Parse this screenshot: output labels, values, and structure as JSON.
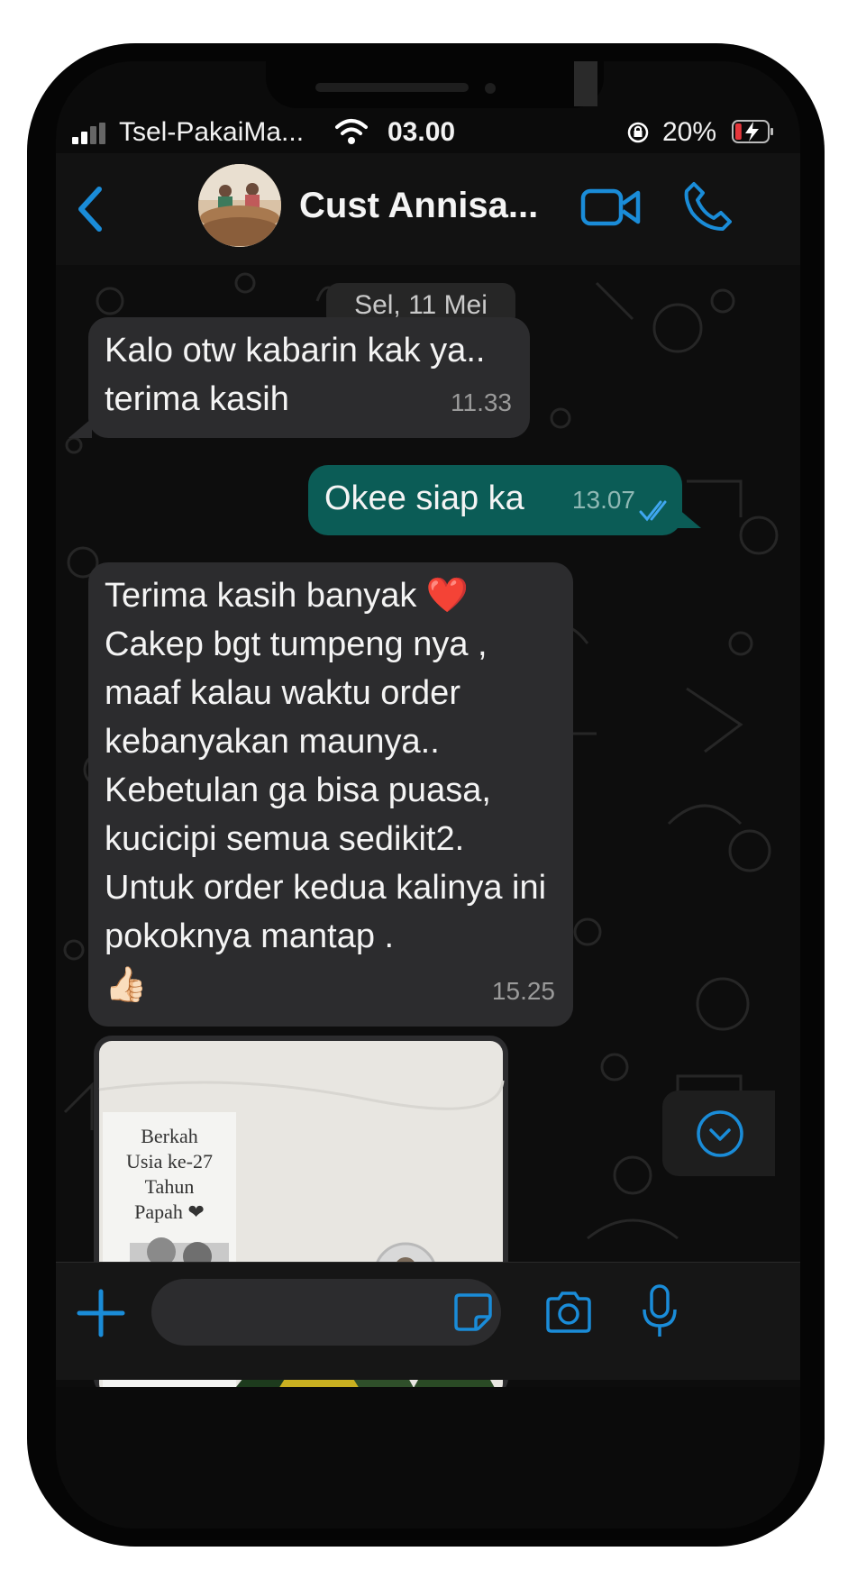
{
  "status_bar": {
    "carrier": "Tsel-PakaiMa...",
    "time": "03.00",
    "battery_percent": "20%",
    "battery_level": 0.2
  },
  "header": {
    "contact_name": "Cust Annisa...",
    "accent_color": "#1a8cd8"
  },
  "chat": {
    "date_label": "Sel, 11 Mei",
    "messages": [
      {
        "direction": "incoming",
        "text": "Kalo otw kabarin kak ya..\nterima kasih",
        "time": "11.33"
      },
      {
        "direction": "outgoing",
        "text": "Okee siap ka",
        "time": "13.07",
        "status": "read"
      },
      {
        "direction": "incoming",
        "text": "Terima kasih banyak ❤️\nCakep bgt tumpeng nya ,\nmaaf kalau waktu order\nkebanyakan maunya..\nKebetulan ga bisa puasa,\nkucicipi semua sedikit2.\nUntuk order kedua kalinya ini\npokoknya mantap .\n👍🏻",
        "time": "15.25"
      }
    ],
    "photo": {
      "card_lines": [
        "Berkah",
        "Usia ke-27 Tahun",
        "Papah ❤"
      ]
    }
  },
  "colors": {
    "incoming_bubble": "#2c2c2e",
    "outgoing_bubble": "#0b5c56",
    "icon_blue": "#1a8cd8"
  }
}
